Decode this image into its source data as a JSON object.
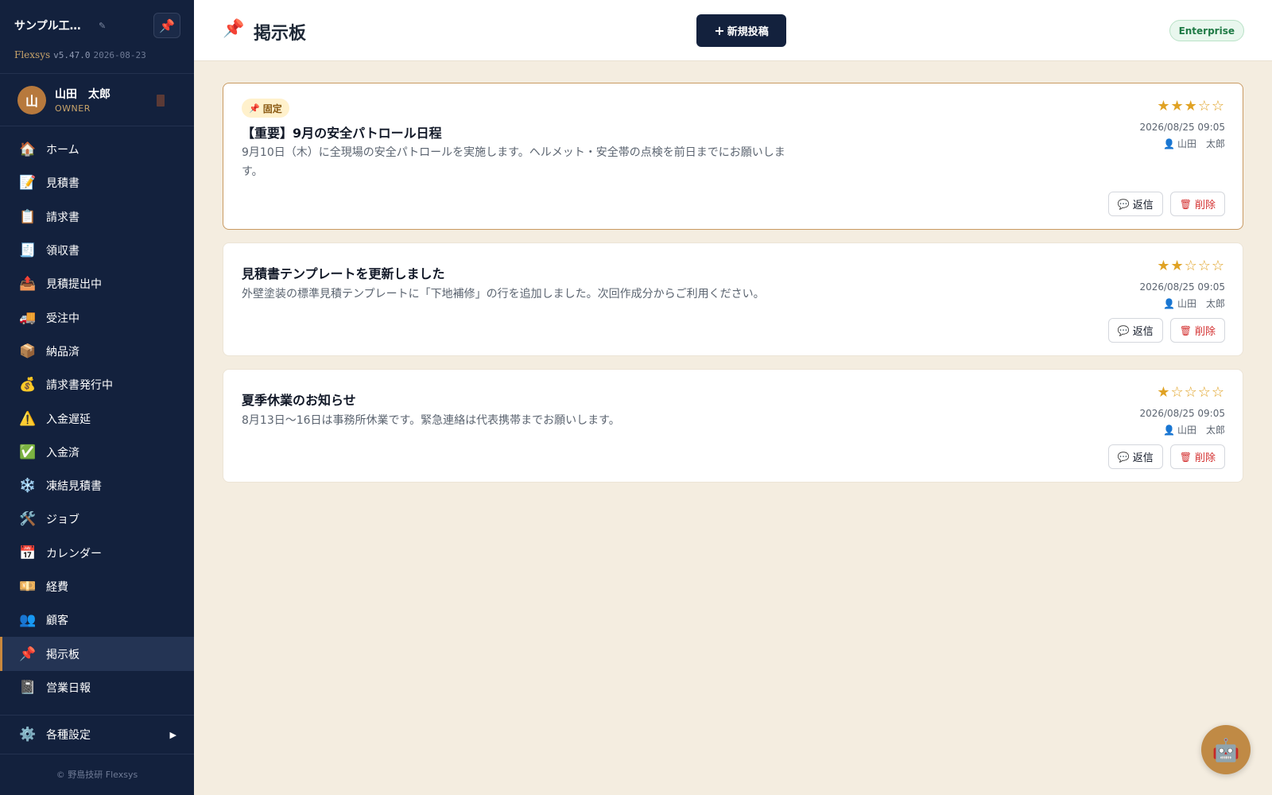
{
  "sidebar": {
    "company_name": "サンプル工…",
    "edit_icon": "✎",
    "pin_icon": "📌",
    "brand": "Flexsys",
    "version": "v5.47.0",
    "date": "2026-08-23",
    "user": {
      "avatar_initial": "山",
      "name": "山田　太郎",
      "role": "OWNER"
    },
    "nav": [
      {
        "icon": "🏠",
        "label": "ホーム",
        "name": "home"
      },
      {
        "icon": "📝",
        "label": "見積書",
        "name": "estimates"
      },
      {
        "icon": "📋",
        "label": "請求書",
        "name": "invoices"
      },
      {
        "icon": "🧾",
        "label": "領収書",
        "name": "receipts"
      },
      {
        "icon": "📤",
        "label": "見積提出中",
        "name": "estimate-submitted"
      },
      {
        "icon": "🚚",
        "label": "受注中",
        "name": "orders"
      },
      {
        "icon": "📦",
        "label": "納品済",
        "name": "delivered"
      },
      {
        "icon": "💰",
        "label": "請求書発行中",
        "name": "invoicing"
      },
      {
        "icon": "⚠️",
        "label": "入金遅延",
        "name": "payment-overdue"
      },
      {
        "icon": "✅",
        "label": "入金済",
        "name": "paid"
      },
      {
        "icon": "❄️",
        "label": "凍結見積書",
        "name": "frozen-estimates"
      },
      {
        "icon": "🛠️",
        "label": "ジョブ",
        "name": "jobs"
      },
      {
        "icon": "📅",
        "label": "カレンダー",
        "name": "calendar"
      },
      {
        "icon": "💴",
        "label": "経費",
        "name": "expenses"
      },
      {
        "icon": "👥",
        "label": "顧客",
        "name": "customers"
      },
      {
        "icon": "📌",
        "label": "掲示板",
        "name": "bulletin-board",
        "active": true
      },
      {
        "icon": "📓",
        "label": "営業日報",
        "name": "sales-daily-report"
      }
    ],
    "settings": {
      "icon": "⚙️",
      "label": "各種設定",
      "arrow": "▶"
    },
    "footer": "© 野島技研 Flexsys"
  },
  "header": {
    "icon": "📌",
    "title": "掲示板",
    "new_post_plus": "+",
    "new_post_label": "新規投稿",
    "plan_badge": "Enterprise"
  },
  "posts": [
    {
      "pinned": true,
      "pin_icon": "📌",
      "pin_label": "固定",
      "title": "【重要】9月の安全パトロール日程",
      "body": "9月10日（木）に全現場の安全パトロールを実施します。ヘルメット・安全帯の点検を前日までにお願いします。",
      "stars": "★★★☆☆",
      "rating": 3,
      "date": "2026/08/25 09:05",
      "author": "山田　太郎",
      "reply_label": "返信",
      "delete_label": "削除"
    },
    {
      "pinned": false,
      "title": "見積書テンプレートを更新しました",
      "body": "外壁塗装の標準見積テンプレートに「下地補修」の行を追加しました。次回作成分からご利用ください。",
      "stars": "★★☆☆☆",
      "rating": 2,
      "date": "2026/08/25 09:05",
      "author": "山田　太郎",
      "reply_label": "返信",
      "delete_label": "削除"
    },
    {
      "pinned": false,
      "title": "夏季休業のお知らせ",
      "body": "8月13日〜16日は事務所休業です。緊急連絡は代表携帯までお願いします。",
      "stars": "★☆☆☆☆",
      "rating": 1,
      "date": "2026/08/25 09:05",
      "author": "山田　太郎",
      "reply_label": "返信",
      "delete_label": "削除"
    }
  ],
  "icons": {
    "user": "👤",
    "reply": "💬",
    "delete": "🗑",
    "bot": "🤖"
  },
  "colors": {
    "sidebar_bg": "#13213d",
    "accent": "#c9883d",
    "page_bg": "#f4ede0",
    "star": "#e0a224",
    "delete": "#d32f2f"
  }
}
